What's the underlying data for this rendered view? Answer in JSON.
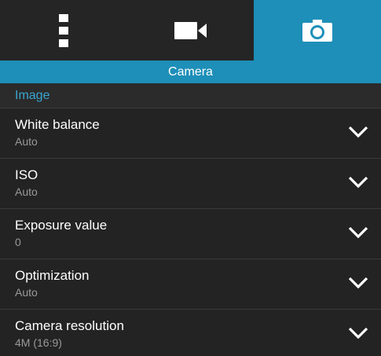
{
  "tabs": [
    {
      "icon": "more-vert-icon",
      "active": false
    },
    {
      "icon": "video-camera-icon",
      "active": false
    },
    {
      "icon": "camera-icon",
      "active": true
    }
  ],
  "header": {
    "title": "Camera"
  },
  "group": {
    "label": "Image"
  },
  "settings": [
    {
      "title": "White balance",
      "value": "Auto"
    },
    {
      "title": "ISO",
      "value": "Auto"
    },
    {
      "title": "Exposure value",
      "value": "0"
    },
    {
      "title": "Optimization",
      "value": "Auto"
    },
    {
      "title": "Camera resolution",
      "value": "4M (16:9)"
    }
  ],
  "colors": {
    "accent": "#1e8fb8",
    "group_label": "#39a6d0",
    "background": "#232323"
  }
}
